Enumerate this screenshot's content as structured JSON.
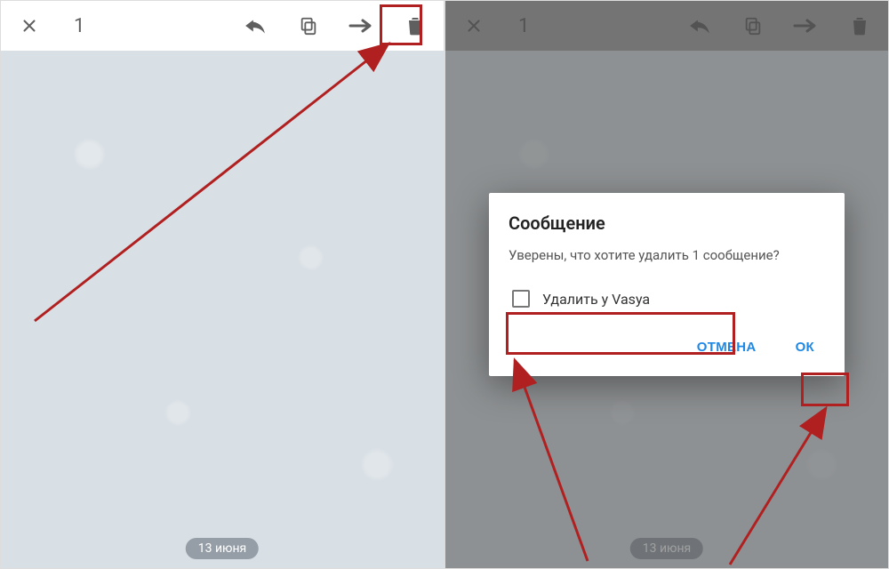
{
  "left": {
    "toolbar": {
      "count": "1",
      "close_name": "close-icon",
      "reply_name": "reply-icon",
      "copy_name": "copy-icon",
      "forward_name": "forward-icon",
      "delete_name": "trash-icon"
    },
    "date_pill": "13 июня"
  },
  "right": {
    "toolbar": {
      "count": "1"
    },
    "date_pill": "13 июня",
    "dialog": {
      "title": "Сообщение",
      "body": "Уверены, что хотите удалить 1 сообщение?",
      "checkbox_label": "Удалить у Vasya",
      "cancel": "ОТМЕНА",
      "ok": "ОК"
    }
  },
  "colors": {
    "highlight": "#b12020",
    "accent": "#1e88e5"
  }
}
